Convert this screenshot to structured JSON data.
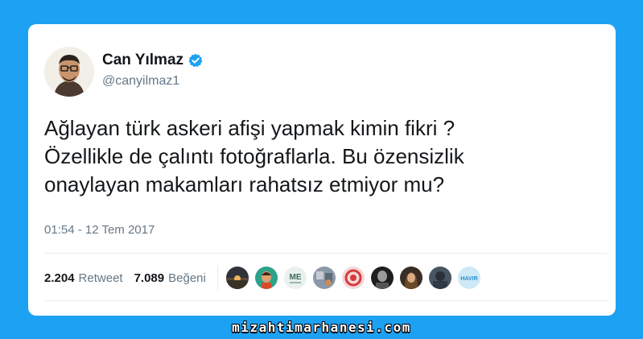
{
  "author": {
    "name": "Can Yılmaz",
    "handle": "@canyilmaz1",
    "verified": true
  },
  "tweet": {
    "text": "Ağlayan türk askeri afişi yapmak kimin fikri ?\nÖzellikle de çalıntı fotoğraflarla. Bu özensizlik\nonaylayan makamları rahatsız etmiyor mu?",
    "timestamp": "01:54 - 12 Tem 2017"
  },
  "stats": {
    "retweets": {
      "count": "2.204",
      "label": "Retweet"
    },
    "likes": {
      "count": "7.089",
      "label": "Beğeni"
    }
  },
  "likers": [
    {
      "icon": "avatar-sunset-icon"
    },
    {
      "icon": "avatar-cartoon-icon"
    },
    {
      "icon": "avatar-me-logo-icon",
      "text": "ME"
    },
    {
      "icon": "avatar-room-icon"
    },
    {
      "icon": "avatar-red-pattern-icon"
    },
    {
      "icon": "avatar-bw-man-icon"
    },
    {
      "icon": "avatar-woman-icon"
    },
    {
      "icon": "avatar-dark-photo-icon"
    },
    {
      "icon": "avatar-havir-logo-icon",
      "text": "HAVIR"
    }
  ],
  "watermark": "mizahtimarhanesi.com",
  "colors": {
    "background": "#1da1f2",
    "card": "#ffffff",
    "text": "#14171a",
    "muted": "#657786",
    "verified": "#1da1f2"
  }
}
